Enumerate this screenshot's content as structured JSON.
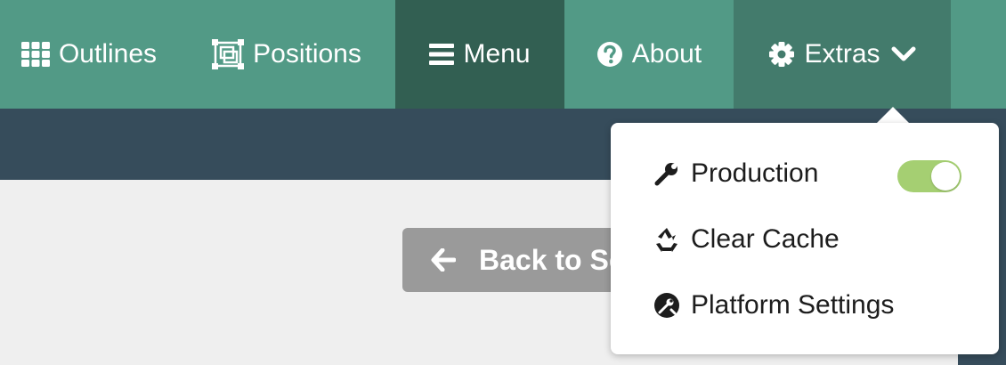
{
  "navbar": {
    "items": [
      {
        "label": "Outlines",
        "icon": "grid-icon"
      },
      {
        "label": "Positions",
        "icon": "positions-icon"
      },
      {
        "label": "Menu",
        "icon": "bars-icon"
      },
      {
        "label": "About",
        "icon": "question-circle-icon"
      },
      {
        "label": "Extras",
        "icon": "gear-icon"
      }
    ],
    "active_item": "Menu",
    "open_item": "Extras"
  },
  "back_button": {
    "label": "Back to Se"
  },
  "extras_menu": {
    "items": [
      {
        "label": "Production",
        "icon": "wrench-icon"
      },
      {
        "label": "Clear Cache",
        "icon": "recycle-icon"
      },
      {
        "label": "Platform Settings",
        "icon": "platform-settings-icon"
      }
    ],
    "production_toggle": {
      "on": true
    }
  },
  "colors": {
    "navbar": "#529a86",
    "nav_active": "#325f52",
    "nav_open": "#437b6c",
    "subbar": "#364c5b",
    "toggle_on": "#a5cf72",
    "back_button": "#9a9a9a"
  }
}
